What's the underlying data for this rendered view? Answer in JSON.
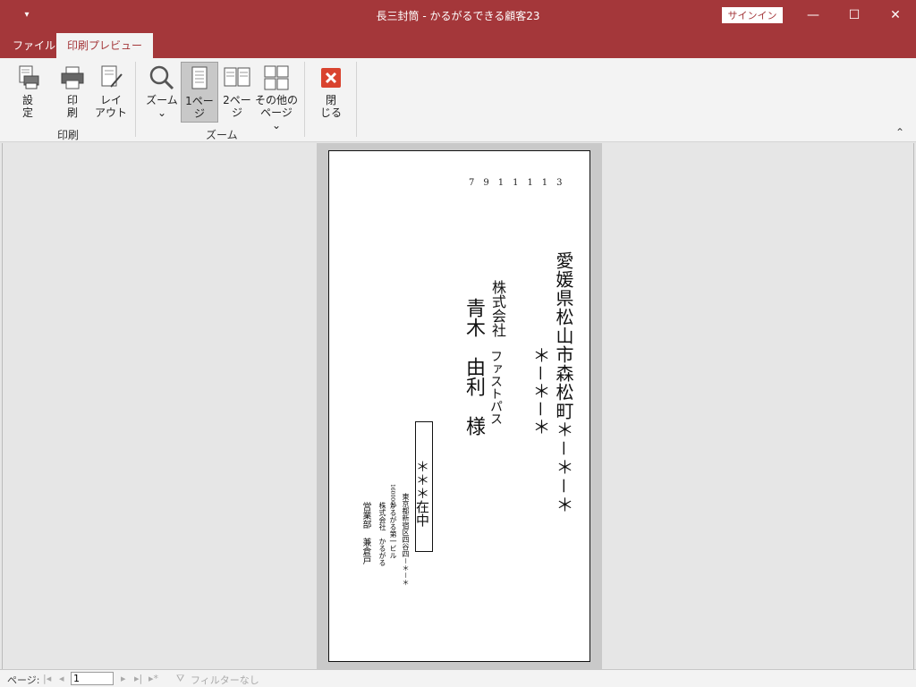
{
  "window": {
    "title": "長三封筒 - かるがるできる顧客23",
    "signin_label": "サインイン",
    "qat_icon": "▾",
    "minimize": "—",
    "maximize": "☐",
    "close": "✕"
  },
  "tabs": [
    {
      "label": "ファイル"
    },
    {
      "label": "印刷プレビュー"
    }
  ],
  "ribbon": {
    "groups": [
      {
        "label": "印刷"
      },
      {
        "label": "ズーム"
      }
    ],
    "buttons": {
      "setup": {
        "line1": "設",
        "line2": "定"
      },
      "print": {
        "line1": "印",
        "line2": "刷"
      },
      "layout": {
        "line1": "レイ",
        "line2": "アウト"
      },
      "zoom": {
        "line1": "ズーム",
        "line2": "⌄"
      },
      "one_page": {
        "line1": "1ペー",
        "line2": "ジ"
      },
      "two_page": {
        "line1": "2ペー",
        "line2": "ジ"
      },
      "other_pages": {
        "line1": "その他の",
        "line2": "ページ ⌄"
      },
      "close_preview": {
        "line1": "閉",
        "line2": "じる"
      }
    },
    "collapse_icon": "⌃"
  },
  "envelope": {
    "zip": "7911113",
    "address_line1": "愛媛県松山市森松町＊－＊－＊",
    "address_line2": "＊－＊－＊",
    "company": "株式会社",
    "department": "ファストパス",
    "recipient": "青木　由利　様",
    "zaichu": "＊＊＊在中",
    "sender_zip": "1600004",
    "sender_address": "東京都新宿区四谷四－＊－＊",
    "sender_address2": "かるがる第一ビル",
    "sender_company": "株式会社　かるがる",
    "sender_name": "営業部　兼倉戸"
  },
  "statusbar": {
    "page_label": "ページ:",
    "page_value": "1",
    "nav_first": "|◂",
    "nav_prev": "◂",
    "nav_next": "▸",
    "nav_last": "▸|",
    "nav_new": "▸*",
    "filter_icon": "⛛",
    "filter_label": "フィルターなし"
  },
  "colors": {
    "accent": "#a4373a",
    "close_button": "#d9432f"
  }
}
